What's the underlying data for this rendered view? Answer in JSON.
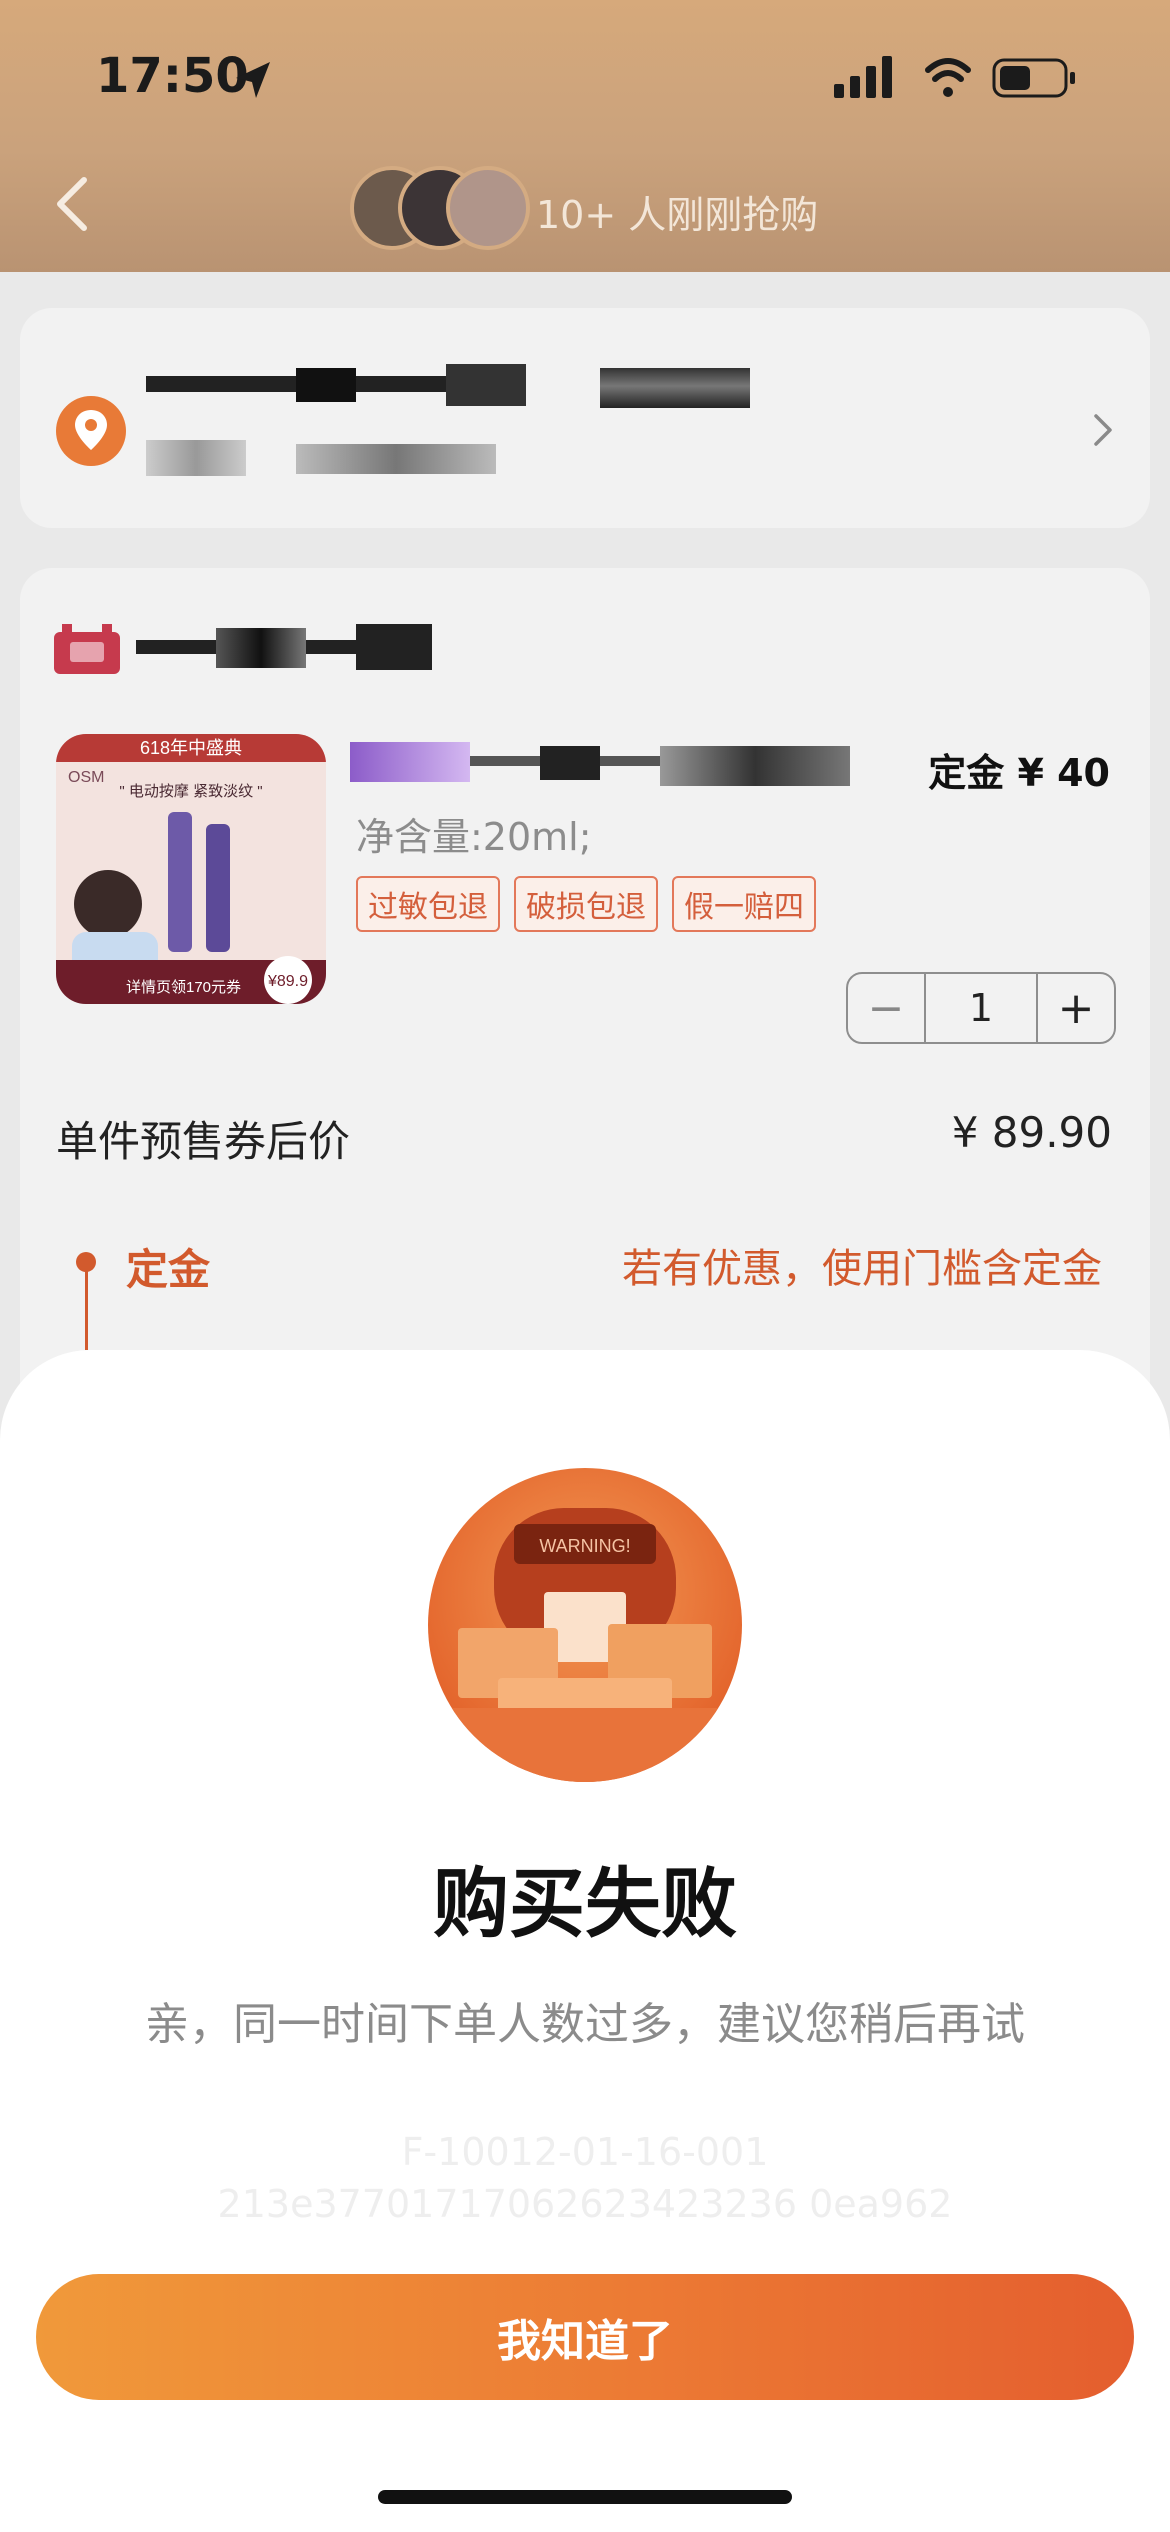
{
  "status_bar": {
    "time": "17:50"
  },
  "header": {
    "buyers_text": "10+ 人刚刚抢购"
  },
  "product": {
    "deposit": "定金 ¥ 40",
    "spec": "净含量:20ml;",
    "tags": [
      "过敏包退",
      "破损包退",
      "假一赔四"
    ],
    "quantity": "1",
    "image_text_banner": "618年中盛典",
    "image_text_brand": "OSM",
    "image_text_slogan": "\" 电动按摩 紧致淡纹 \"",
    "image_text_coupon": "详情页领170元券",
    "image_text_price": "¥89.9"
  },
  "pricing": {
    "unit_label": "单件预售券后价",
    "unit_price": "¥ 89.90",
    "deposit_label": "定金",
    "deposit_note": "若有优惠，使用门槛含定金"
  },
  "modal": {
    "illustration_text": "WARNING!",
    "title": "购买失败",
    "message": "亲，同一时间下单人数过多，建议您稍后再试",
    "error_code_1": "F-10012-01-16-001",
    "error_code_2": "213e37701717062623423236 0ea962",
    "ok_label": "我知道了"
  },
  "colors": {
    "accent": "#e86a30",
    "header_bg": "#d2a67c"
  }
}
